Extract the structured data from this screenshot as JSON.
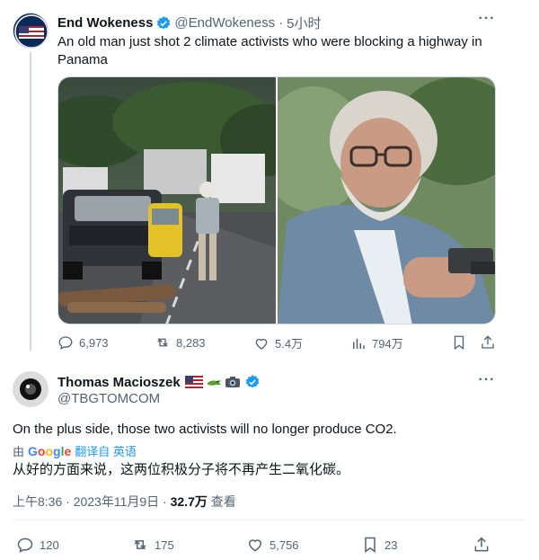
{
  "tweet1": {
    "author_name": "End Wokeness",
    "author_handle": "@EndWokeness",
    "separator": "·",
    "time": "5小时",
    "text": "An old man just shot 2 climate activists who were blocking a highway in Panama",
    "stats": {
      "replies": "6,973",
      "retweets": "8,283",
      "likes": "5.4万",
      "views": "794万"
    }
  },
  "tweet2": {
    "author_name": "Thomas Macioszek",
    "author_handle": "@TBGTOMCOM",
    "badges": [
      "flag-usa",
      "alligator",
      "camera"
    ],
    "text": "On the plus side, those two activists will no longer produce CO2.",
    "translate": {
      "by": "由",
      "google_letters": [
        "G",
        "o",
        "o",
        "g",
        "l",
        "e"
      ],
      "google_colors": [
        "#4285f4",
        "#ea4335",
        "#fbbc05",
        "#4285f4",
        "#34a853",
        "#ea4335"
      ],
      "link": "翻译自 英语"
    },
    "translation": "从好的方面来说，这两位积极分子将不再产生二氧化碳。",
    "meta": {
      "datetime": "上午8:36 · 2023年11月9日 · ",
      "views_count": "32.7万",
      "views_label": " 查看"
    },
    "stats": {
      "replies": "120",
      "retweets": "175",
      "likes": "5,756",
      "bookmarks": "23"
    }
  },
  "colors": {
    "verified": "#1d9bf0",
    "text_secondary": "#536471",
    "link": "#1d9bf0"
  }
}
